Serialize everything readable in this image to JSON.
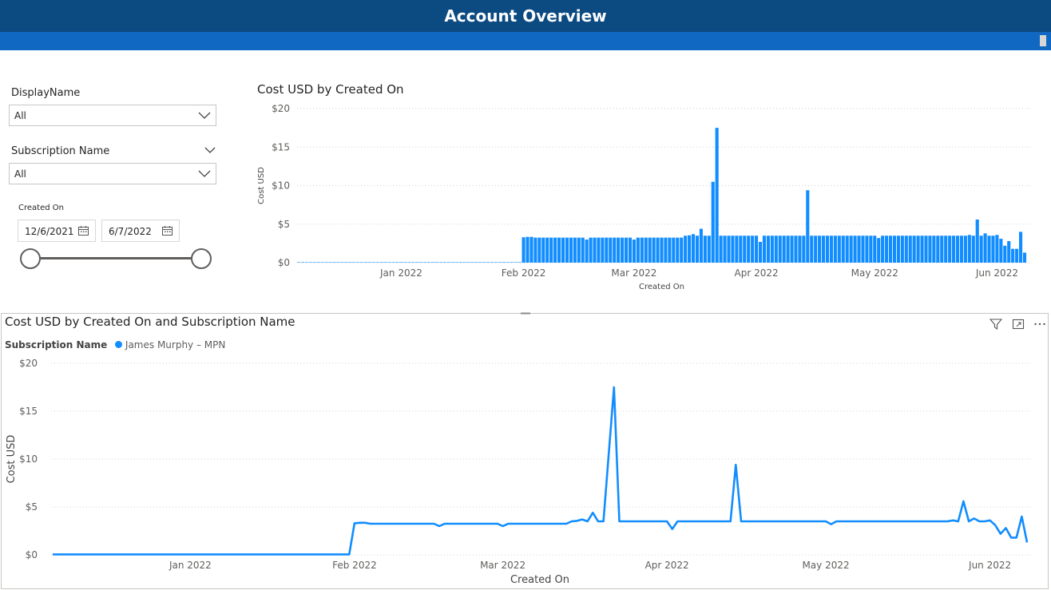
{
  "header": {
    "title": "Account Overview"
  },
  "filters": {
    "display_name": {
      "label": "DisplayName",
      "value": "All"
    },
    "subscription_name": {
      "label": "Subscription Name",
      "value": "All"
    },
    "created_on": {
      "label": "Created On",
      "start": "12/6/2021",
      "end": "6/7/2022"
    }
  },
  "colors": {
    "header": "#0c4a82",
    "subheader": "#1168c3",
    "series": "#118dff"
  },
  "icons": [
    "chevron-down-icon",
    "calendar-icon",
    "filter-icon",
    "focus-mode-icon",
    "more-options-icon"
  ],
  "chart_data": [
    {
      "type": "bar",
      "title": "Cost USD by Created On",
      "xlabel": "Created On",
      "ylabel": "Cost USD",
      "ylim": [
        0,
        20
      ],
      "yticks": [
        "$0",
        "$5",
        "$10",
        "$15",
        "$20"
      ],
      "xticks": [
        "Jan 2022",
        "Feb 2022",
        "Mar 2022",
        "Apr 2022",
        "May 2022",
        "Jun 2022"
      ],
      "grid": true,
      "x_start": "2021-12-06",
      "x_end": "2022-06-07",
      "points": [
        [
          "2021-12-06",
          0.05
        ],
        [
          "2022-01-31",
          0.05
        ],
        [
          "2022-02-01",
          3.3
        ],
        [
          "2022-02-02",
          3.35
        ],
        [
          "2022-02-04",
          3.25
        ],
        [
          "2022-02-16",
          3.25
        ],
        [
          "2022-02-17",
          3.0
        ],
        [
          "2022-02-18",
          3.25
        ],
        [
          "2022-02-28",
          3.25
        ],
        [
          "2022-03-01",
          3.0
        ],
        [
          "2022-03-02",
          3.25
        ],
        [
          "2022-03-13",
          3.25
        ],
        [
          "2022-03-14",
          3.5
        ],
        [
          "2022-03-15",
          3.55
        ],
        [
          "2022-03-16",
          3.7
        ],
        [
          "2022-03-17",
          3.5
        ],
        [
          "2022-03-18",
          4.4
        ],
        [
          "2022-03-19",
          3.5
        ],
        [
          "2022-03-20",
          3.5
        ],
        [
          "2022-03-21",
          10.5
        ],
        [
          "2022-03-22",
          17.5
        ],
        [
          "2022-03-23",
          3.5
        ],
        [
          "2022-04-01",
          3.5
        ],
        [
          "2022-04-02",
          2.7
        ],
        [
          "2022-04-03",
          3.5
        ],
        [
          "2022-04-13",
          3.5
        ],
        [
          "2022-04-14",
          9.4
        ],
        [
          "2022-04-15",
          3.5
        ],
        [
          "2022-05-01",
          3.5
        ],
        [
          "2022-05-02",
          3.2
        ],
        [
          "2022-05-03",
          3.5
        ],
        [
          "2022-05-24",
          3.5
        ],
        [
          "2022-05-25",
          3.6
        ],
        [
          "2022-05-26",
          3.5
        ],
        [
          "2022-05-27",
          5.6
        ],
        [
          "2022-05-28",
          3.5
        ],
        [
          "2022-05-29",
          3.8
        ],
        [
          "2022-05-30",
          3.5
        ],
        [
          "2022-05-31",
          3.5
        ],
        [
          "2022-06-01",
          3.6
        ],
        [
          "2022-06-02",
          3.1
        ],
        [
          "2022-06-03",
          2.2
        ],
        [
          "2022-06-04",
          2.8
        ],
        [
          "2022-06-05",
          1.8
        ],
        [
          "2022-06-06",
          1.8
        ],
        [
          "2022-06-07",
          4.0
        ],
        [
          "2022-06-08",
          1.3
        ]
      ]
    },
    {
      "type": "line",
      "title": "Cost USD by Created On and Subscription Name",
      "legend_title": "Subscription Name",
      "series": [
        {
          "name": "James Murphy – MPN"
        }
      ],
      "xlabel": "Created On",
      "ylabel": "Cost USD",
      "ylim": [
        0,
        20
      ],
      "yticks": [
        "$0",
        "$5",
        "$10",
        "$15",
        "$20"
      ],
      "xticks": [
        "Jan 2022",
        "Feb 2022",
        "Mar 2022",
        "Apr 2022",
        "May 2022",
        "Jun 2022"
      ],
      "grid": true
    }
  ]
}
